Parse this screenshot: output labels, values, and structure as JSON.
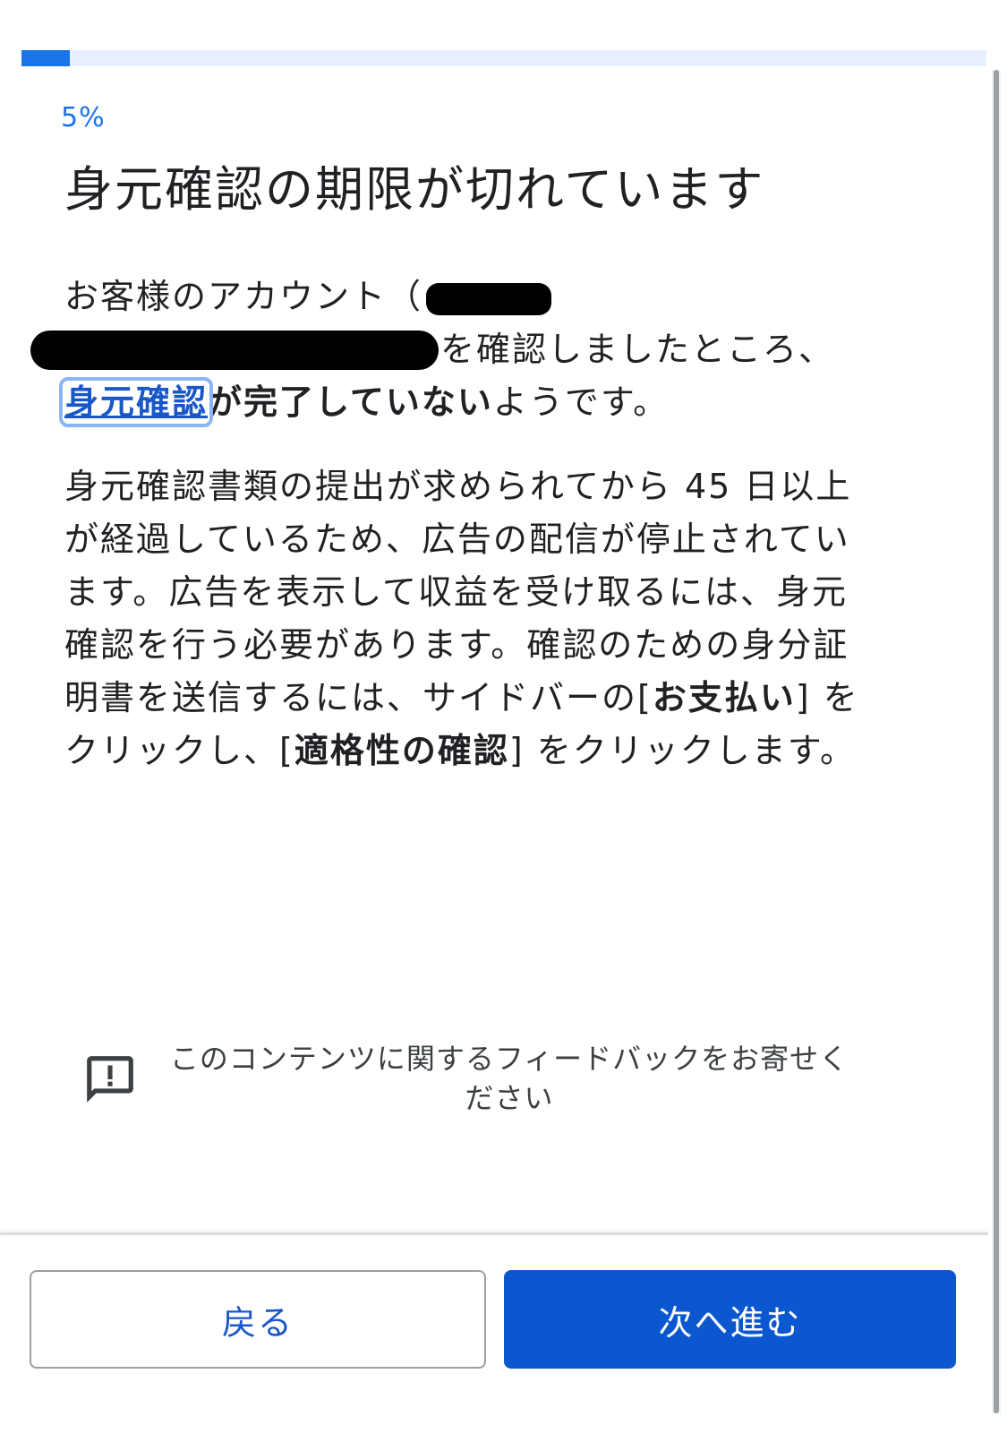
{
  "progress": {
    "percent_label": "5%",
    "fraction": 0.05
  },
  "title": "身元確認の期限が切れています",
  "paragraph1": {
    "line1_prefix": "お客様のアカウント（",
    "line2_suffix": "を確認しましたところ、",
    "link_text": "身元確認",
    "bold_text": "が完了していない",
    "after_bold": "ようです。"
  },
  "paragraph2": {
    "text_a": "身元確認書類の提出が求められてから 45 日以上が経過しているため、広告の配信が停止されています。広告を表示して収益を受け取るには、身元確認を行う必要があります。確認のための身分証明書を送信するには、サイドバーの",
    "bracket_open_1": "[",
    "bold_1": "お支払い",
    "text_b": "] をクリックし、[",
    "bold_2": "適格性の確認",
    "text_c": "] をクリックします。"
  },
  "feedback": {
    "icon": "feedback-icon",
    "text": "このコンテンツに関するフィードバックをお寄せください"
  },
  "buttons": {
    "back": "戻る",
    "next": "次へ進む"
  },
  "colors": {
    "accent": "#1a73e8",
    "primary_button": "#0b57d0",
    "link": "#1a57c8"
  }
}
